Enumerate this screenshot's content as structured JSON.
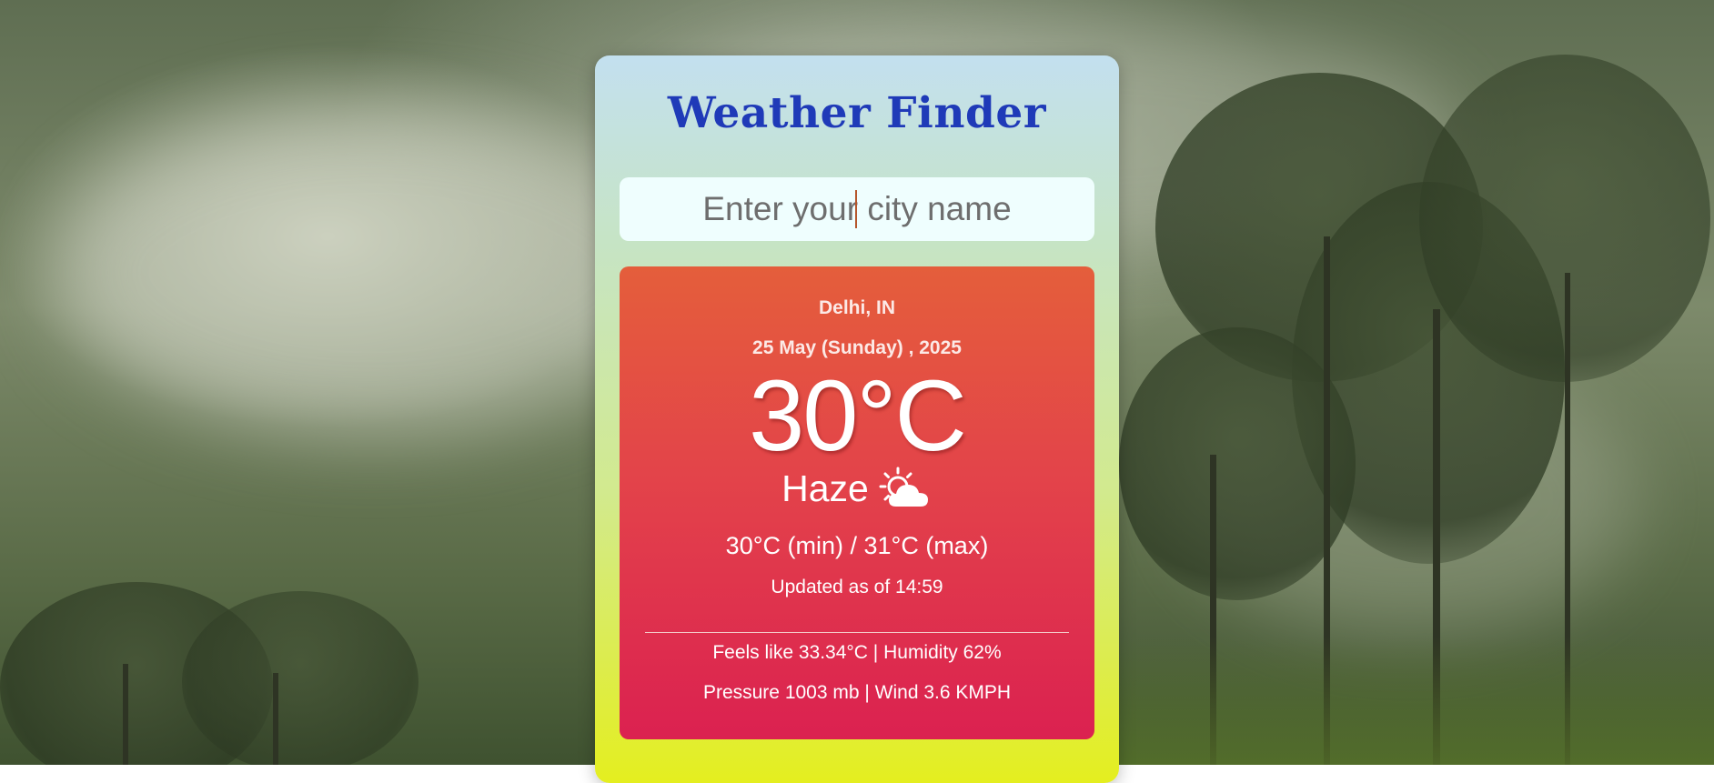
{
  "app": {
    "title": "Weather Finder"
  },
  "search": {
    "placeholder": "Enter your city name",
    "value": ""
  },
  "weather": {
    "location": "Delhi, IN",
    "date": "25 May (Sunday) , 2025",
    "temperature": "30°C",
    "condition": "Haze",
    "condition_icon": "sun-behind-cloud-icon",
    "min_max": "30°C (min) / 31°C (max)",
    "updated": "Updated as of 14:59",
    "feels_humidity": "Feels like 33.34°C | Humidity 62%",
    "pressure_wind": "Pressure 1003 mb | Wind 3.6 KMPH"
  },
  "colors": {
    "title": "#1f3ab8",
    "panel_top": "#e45e3b",
    "panel_bottom": "#db2150",
    "card_top": "#c3e0ef",
    "card_bottom": "#e4ee1f"
  }
}
